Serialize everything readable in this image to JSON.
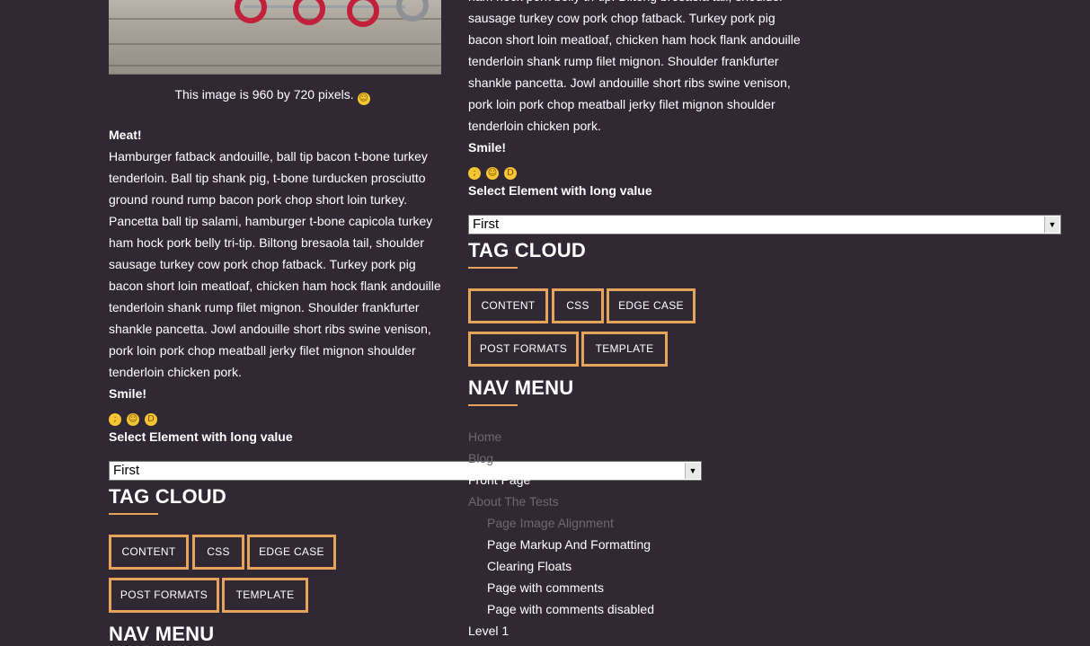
{
  "left": {
    "caption": "This image is 960 by 720 pixels.",
    "meat_heading": "Meat!",
    "meat_lines": [
      "Hamburger fatback andouille, ball tip bacon t-bone turkey",
      "tenderloin. Ball tip shank pig, t-bone turducken prosciutto",
      "ground round rump bacon pork chop short loin turkey.",
      "Pancetta ball tip salami, hamburger t-bone capicola turkey",
      "ham hock pork belly tri-tip. Biltong bresaola tail, shoulder",
      "sausage turkey cow pork chop fatback. Turkey pork pig",
      "bacon short loin meatloaf, chicken ham hock flank andouille",
      "tenderloin shank rump filet mignon. Shoulder frankfurter",
      "shankle pancetta. Jowl andouille short ribs swine venison,",
      "pork loin pork chop meatball jerky filet mignon shoulder",
      "tenderloin chicken pork."
    ],
    "smile_heading": "Smile!",
    "select_heading": "Select Element with long value",
    "select_value": "First",
    "tag_cloud_title": "TAG CLOUD",
    "tags": [
      "CONTENT",
      "CSS",
      "EDGE CASE",
      "POST FORMATS",
      "TEMPLATE"
    ],
    "nav_menu_title": "NAV MENU"
  },
  "right": {
    "top_lines": [
      "ham hock pork belly tri-tip. Biltong bresaola tail, shoulder",
      "sausage turkey cow pork chop fatback. Turkey pork pig",
      "bacon short loin meatloaf, chicken ham hock flank andouille",
      "tenderloin shank rump filet mignon. Shoulder frankfurter",
      "shankle pancetta. Jowl andouille short ribs swine venison,",
      "pork loin pork chop meatball jerky filet mignon shoulder",
      "tenderloin chicken pork."
    ],
    "smile_heading": "Smile!",
    "select_heading": "Select Element with long value",
    "select_value": "First",
    "tag_cloud_title": "TAG CLOUD",
    "tags": [
      "CONTENT",
      "CSS",
      "EDGE CASE",
      "POST FORMATS",
      "TEMPLATE"
    ],
    "nav_menu_title": "NAV MENU",
    "nav_items": [
      {
        "label": "Home",
        "level": 0,
        "style": "muted"
      },
      {
        "label": "Blog",
        "level": 0,
        "style": "muted"
      },
      {
        "label": "Front Page",
        "level": 0,
        "style": "white"
      },
      {
        "label": "About The Tests",
        "level": 0,
        "style": "muted"
      },
      {
        "label": "Page Image Alignment",
        "level": 1,
        "style": "muted"
      },
      {
        "label": "Page Markup And Formatting",
        "level": 1,
        "style": "white"
      },
      {
        "label": "Clearing Floats",
        "level": 1,
        "style": "white"
      },
      {
        "label": "Page with comments",
        "level": 1,
        "style": "white"
      },
      {
        "label": "Page with comments disabled",
        "level": 1,
        "style": "white"
      },
      {
        "label": "Level 1",
        "level": 0,
        "style": "white"
      }
    ]
  },
  "icons": {
    "emoji_face": "smiley-face-icon",
    "emoji_wink": "winking-face-icon",
    "emoji_grin": "grinning-face-icon",
    "select_arrow": "chevron-down-icon"
  },
  "colors": {
    "background": "#302833",
    "accent": "#e5a35c",
    "muted_link": "#6f6872"
  }
}
